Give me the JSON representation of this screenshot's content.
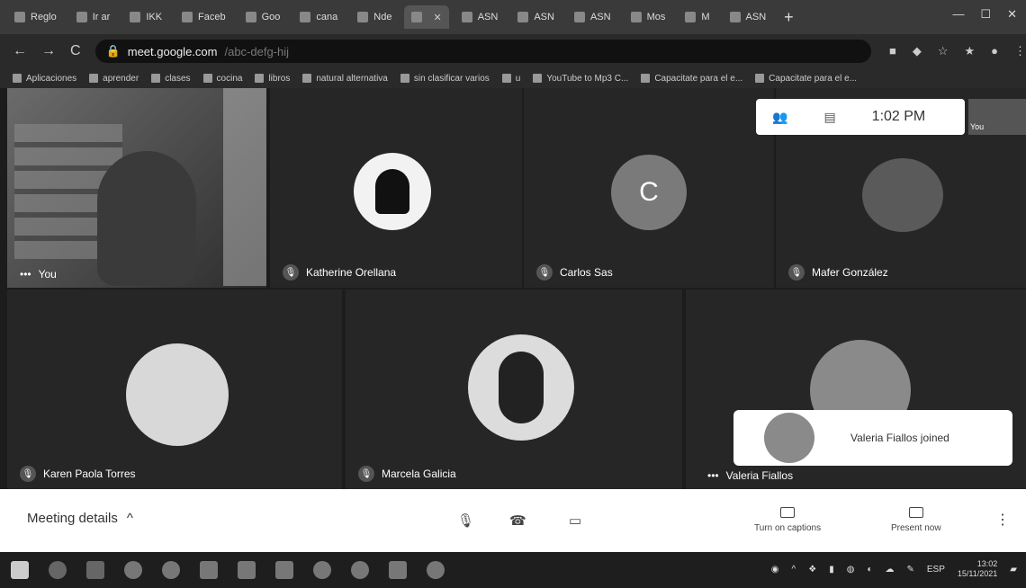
{
  "browser": {
    "tabs": [
      {
        "label": "Reglo"
      },
      {
        "label": "Ir ar"
      },
      {
        "label": "IKK"
      },
      {
        "label": "Faceb"
      },
      {
        "label": "Goo"
      },
      {
        "label": "cana"
      },
      {
        "label": "Nde"
      },
      {
        "label": "",
        "active": true
      },
      {
        "label": "ASN"
      },
      {
        "label": "ASN"
      },
      {
        "label": "ASN"
      },
      {
        "label": "Mos"
      },
      {
        "label": "M"
      },
      {
        "label": "ASN"
      }
    ],
    "new_tab": "+",
    "url_domain": "meet.google.com",
    "url_path": "/abc-defg-hij"
  },
  "bookmarks": [
    "Aplicaciones",
    "aprender",
    "clases",
    "cocina",
    "libros",
    "natural alternativa",
    "sin clasificar varios",
    "u",
    "YouTube to Mp3 C...",
    "Capacitate para el e...",
    "Capacitate para el e..."
  ],
  "meet": {
    "self_label": "You",
    "overlay_time": "1:02 PM",
    "self_mini_label": "You",
    "participants": [
      {
        "name": "Katherine Orellana"
      },
      {
        "name": "Carlos Sas",
        "initial": "C"
      },
      {
        "name": "Mafer González"
      },
      {
        "name": "Karen Paola Torres"
      },
      {
        "name": "Marcela Galicia"
      },
      {
        "name": "Valeria Fiallos"
      }
    ],
    "toast": "Valeria Fiallos joined"
  },
  "controls": {
    "meeting_details": "Meeting details",
    "captions": "Turn on captions",
    "present": "Present now"
  },
  "taskbar": {
    "lang": "ESP",
    "time": "13:02",
    "date": "15/11/2021"
  }
}
